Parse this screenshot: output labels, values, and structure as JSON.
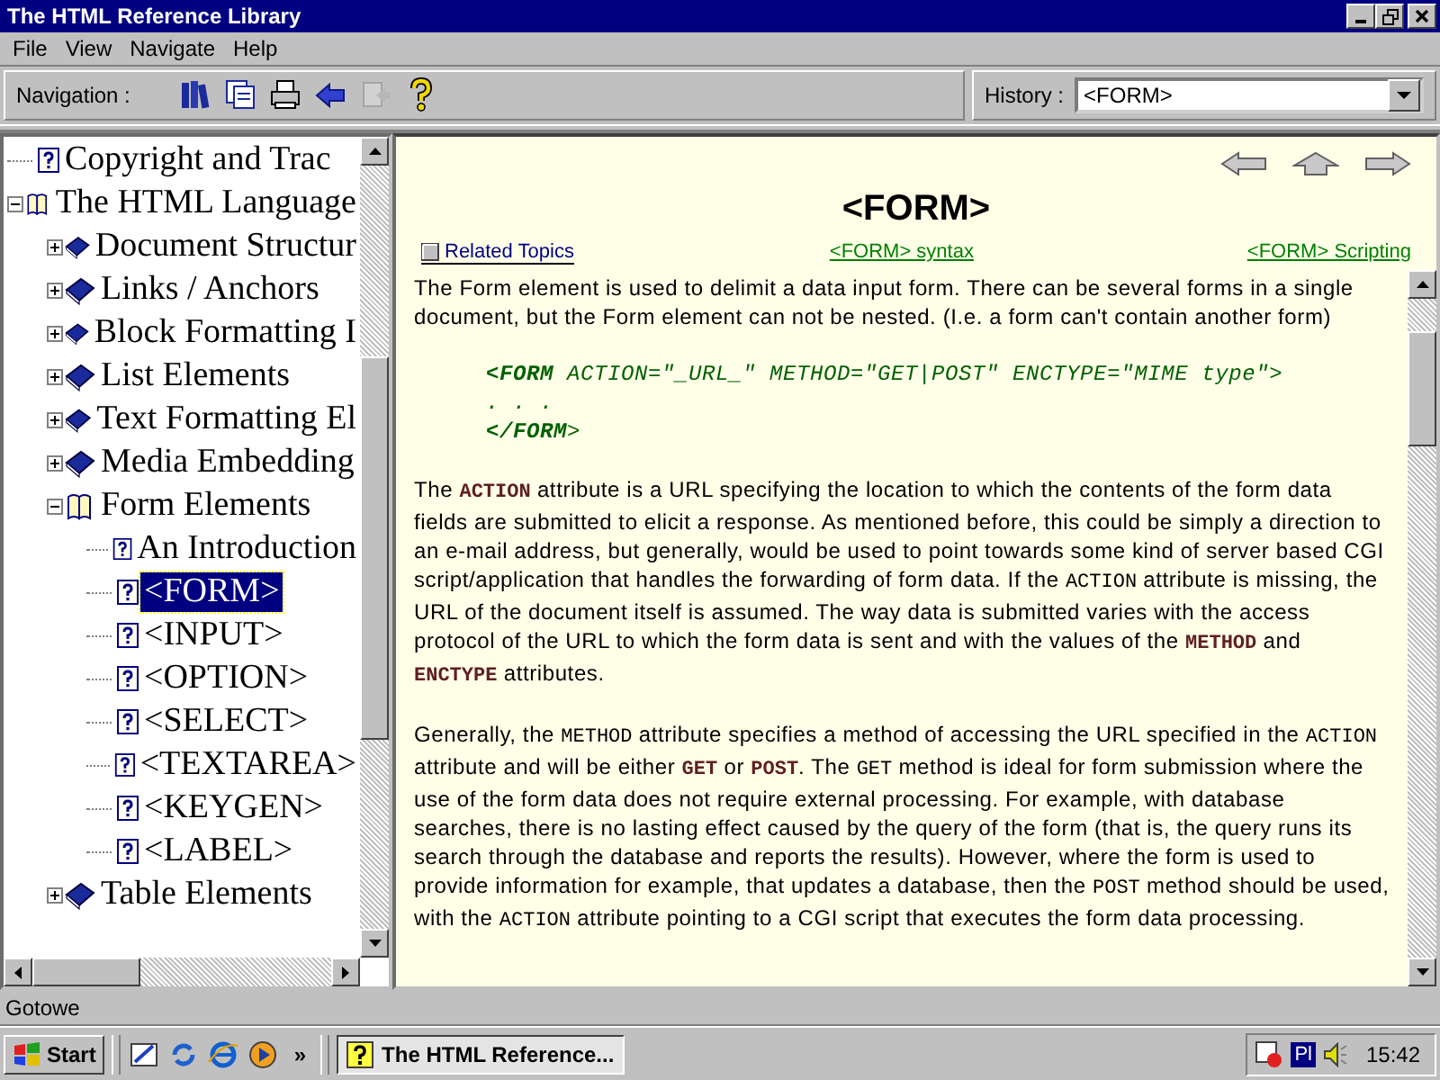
{
  "window": {
    "title": "The HTML Reference Library"
  },
  "menu": [
    "File",
    "View",
    "Navigate",
    "Help"
  ],
  "toolbar": {
    "label": "Navigation :",
    "buttons": [
      {
        "kind": "books",
        "disabled": false
      },
      {
        "kind": "pages",
        "disabled": false
      },
      {
        "kind": "print",
        "disabled": false
      },
      {
        "kind": "back",
        "disabled": false
      },
      {
        "kind": "forward",
        "disabled": true
      },
      {
        "kind": "help",
        "disabled": false
      }
    ]
  },
  "history": {
    "label": "History :",
    "value": "<FORM>"
  },
  "tree": [
    {
      "kind": "page",
      "label": "Copyright and Trac",
      "selected": false
    },
    {
      "kind": "book",
      "label": "The HTML Language",
      "expanded": true,
      "selected": false,
      "children": [
        {
          "kind": "book",
          "label": "Document Structur",
          "expanded": false,
          "selected": false
        },
        {
          "kind": "book",
          "label": "Links / Anchors",
          "expanded": false,
          "selected": false
        },
        {
          "kind": "book",
          "label": "Block Formatting I",
          "expanded": false,
          "selected": false
        },
        {
          "kind": "book",
          "label": "List Elements",
          "expanded": false,
          "selected": false
        },
        {
          "kind": "book",
          "label": "Text Formatting El",
          "expanded": false,
          "selected": false
        },
        {
          "kind": "book",
          "label": "Media Embedding",
          "expanded": false,
          "selected": false
        },
        {
          "kind": "book",
          "label": "Form Elements",
          "expanded": true,
          "selected": false,
          "children": [
            {
              "kind": "page",
              "label": "An Introduction",
              "selected": false
            },
            {
              "kind": "page",
              "label": "<FORM>",
              "selected": true
            },
            {
              "kind": "page",
              "label": "<INPUT>",
              "selected": false
            },
            {
              "kind": "page",
              "label": "<OPTION>",
              "selected": false
            },
            {
              "kind": "page",
              "label": "<SELECT>",
              "selected": false
            },
            {
              "kind": "page",
              "label": "<TEXTAREA>",
              "selected": false
            },
            {
              "kind": "page",
              "label": "<KEYGEN>",
              "selected": false
            },
            {
              "kind": "page",
              "label": "<LABEL>",
              "selected": false
            }
          ]
        },
        {
          "kind": "book",
          "label": "Table Elements",
          "expanded": false,
          "selected": false
        }
      ]
    }
  ],
  "topic": {
    "title": "<FORM>",
    "links": [
      {
        "kind": "related",
        "label": "Related Topics"
      },
      {
        "kind": "link",
        "label": "<FORM> syntax"
      },
      {
        "kind": "link",
        "label": "<FORM> Scripting"
      }
    ],
    "intro": "The Form element is used to delimit a data input form. There can be several forms in a single document, but the Form element can not be nested. (I.e. a form can't contain another form)",
    "code_lines": [
      "**<FORM** ACTION=\"_URL_\" METHOD=\"GET|POST\" ENCTYPE=\"MIME type\">",
      ". . .",
      "**</FORM**>"
    ],
    "paragraphs": [
      [
        {
          "kind": "text",
          "text": "The "
        },
        {
          "kind": "keyword",
          "text": "ACTION"
        },
        {
          "kind": "text",
          "text": " attribute is a URL specifying the location to which the contents of the form data fields are submitted to elicit a response. As mentioned before, this could be simply a direction to an e-mail address, but generally, would be used to point towards some kind of server based CGI script/application that handles the forwarding of form data. If the "
        },
        {
          "kind": "code",
          "text": "ACTION"
        },
        {
          "kind": "text",
          "text": " attribute is missing, the URL of the document itself is assumed. The way data is submitted varies with the access protocol of the URL to which the form data is sent and with the values of the "
        },
        {
          "kind": "keyword",
          "text": "METHOD"
        },
        {
          "kind": "text",
          "text": " and "
        },
        {
          "kind": "keyword",
          "text": "ENCTYPE"
        },
        {
          "kind": "text",
          "text": " attributes."
        }
      ],
      [
        {
          "kind": "text",
          "text": "Generally, the "
        },
        {
          "kind": "code",
          "text": "METHOD"
        },
        {
          "kind": "text",
          "text": " attribute specifies a method of accessing the URL specified in the "
        },
        {
          "kind": "code",
          "text": "ACTION"
        },
        {
          "kind": "text",
          "text": " attribute and will be either "
        },
        {
          "kind": "keyword",
          "text": "GET"
        },
        {
          "kind": "text",
          "text": " or "
        },
        {
          "kind": "keyword",
          "text": "POST"
        },
        {
          "kind": "text",
          "text": ". The "
        },
        {
          "kind": "code",
          "text": "GET"
        },
        {
          "kind": "text",
          "text": " method is ideal for form submission where the use of the form data does not require external processing. For example, with database searches, there is no lasting effect caused by the query of the form (that is, the query runs its search through the database and reports the results). However, where the form is used to provide information for example, that updates a database, then the "
        },
        {
          "kind": "code",
          "text": "POST"
        },
        {
          "kind": "text",
          "text": " method should be used, with the "
        },
        {
          "kind": "code",
          "text": "ACTION"
        },
        {
          "kind": "text",
          "text": " attribute pointing to a CGI script that executes the form data processing."
        }
      ]
    ]
  },
  "status_bar": "Gotowe",
  "taskbar": {
    "start": "Start",
    "more": "»",
    "tasks": [
      {
        "label": "The HTML Reference...",
        "selected": true
      }
    ],
    "tray": {
      "language": "Pl",
      "clock": "15:42"
    }
  }
}
